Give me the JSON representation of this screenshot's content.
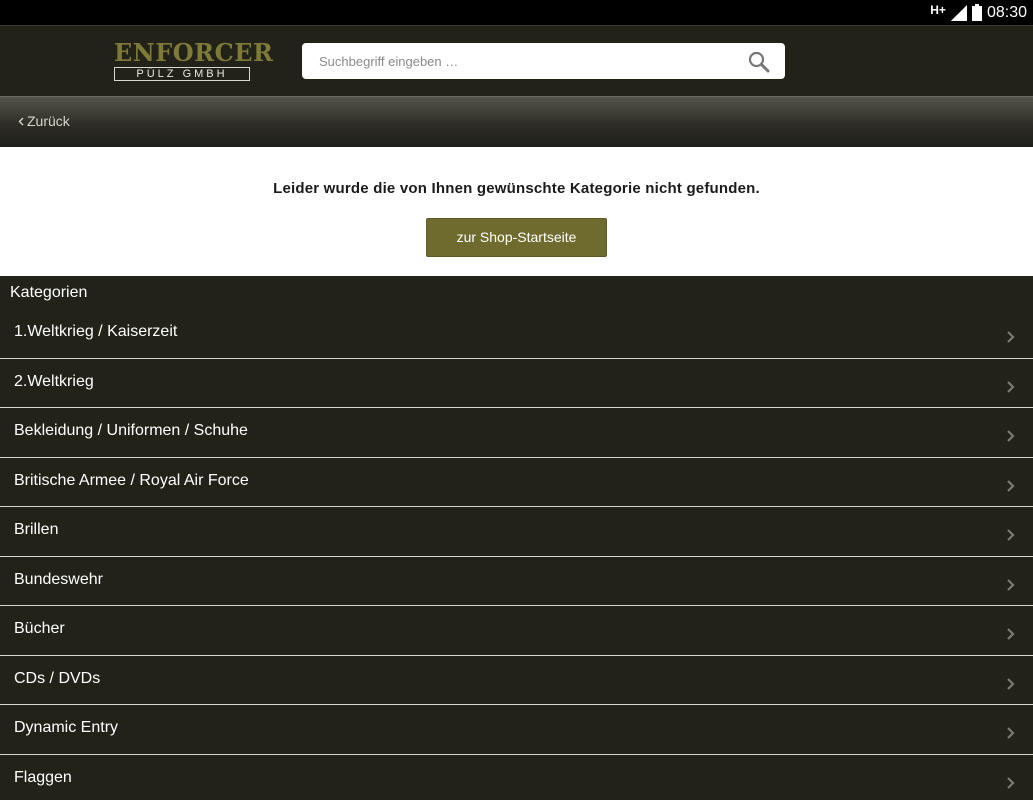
{
  "status_bar": {
    "network": "H+",
    "time": "08:30"
  },
  "header": {
    "logo_top": "ENFORCER",
    "logo_bottom": "PÜLZ GMBH",
    "search_placeholder": "Suchbegriff eingeben …"
  },
  "back": {
    "label": "Zurück"
  },
  "notice": {
    "message": "Leider wurde die von Ihnen gewünschte Kategorie nicht gefunden.",
    "button_label": "zur Shop-Startseite"
  },
  "categories": {
    "heading": "Kategorien",
    "items": [
      "1.Weltkrieg / Kaiserzeit",
      "2.Weltkrieg",
      "Bekleidung / Uniformen / Schuhe",
      "Britische Armee / Royal Air Force",
      "Brillen",
      "Bundeswehr",
      "Bücher",
      "CDs / DVDs",
      "Dynamic Entry",
      "Flaggen"
    ]
  },
  "colors": {
    "background": "#222219",
    "accent": "#6f6b2e",
    "logo": "#7e7a3a"
  },
  "icons": {
    "search": "search-icon",
    "back": "chevron-left-icon",
    "item": "chevron-right-icon",
    "signal": "signal-icon",
    "battery": "battery-icon"
  }
}
